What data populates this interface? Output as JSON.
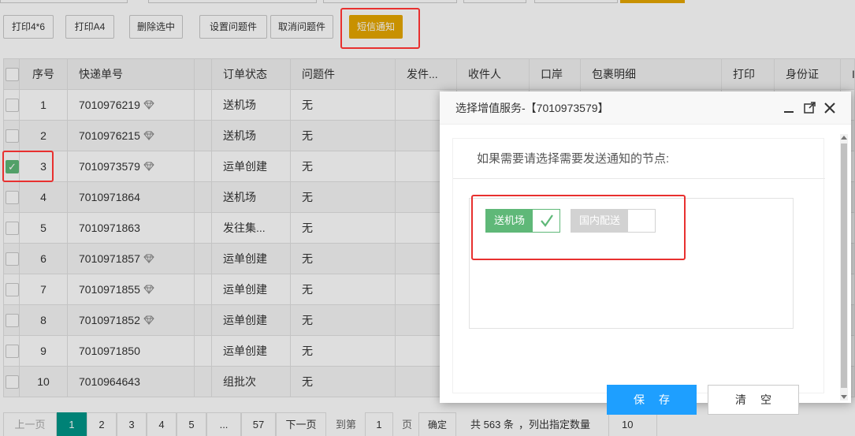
{
  "toolbar": {
    "print_4x6": "打印4*6",
    "print_a4": "打印A4",
    "delete_selected": "删除选中",
    "set_problem": "设置问题件",
    "cancel_problem": "取消问题件",
    "sms_notify": "短信通知"
  },
  "table": {
    "headers": [
      "序号",
      "快递单号",
      "订单状态",
      "问题件",
      "发件...",
      "收件人",
      "口岸",
      "包裹明细",
      "打印",
      "身份证",
      "I"
    ],
    "rows": [
      {
        "no": "1",
        "tracking": "7010976219",
        "gem": true,
        "status": "送机场",
        "problem": "无",
        "checked": false
      },
      {
        "no": "2",
        "tracking": "7010976215",
        "gem": true,
        "status": "送机场",
        "problem": "无",
        "checked": false
      },
      {
        "no": "3",
        "tracking": "7010973579",
        "gem": true,
        "status": "运单创建",
        "problem": "无",
        "checked": true
      },
      {
        "no": "4",
        "tracking": "7010971864",
        "gem": false,
        "status": "送机场",
        "problem": "无",
        "checked": false
      },
      {
        "no": "5",
        "tracking": "7010971863",
        "gem": false,
        "status": "发往集...",
        "problem": "无",
        "checked": false
      },
      {
        "no": "6",
        "tracking": "7010971857",
        "gem": true,
        "status": "运单创建",
        "problem": "无",
        "checked": false
      },
      {
        "no": "7",
        "tracking": "7010971855",
        "gem": true,
        "status": "运单创建",
        "problem": "无",
        "checked": false
      },
      {
        "no": "8",
        "tracking": "7010971852",
        "gem": true,
        "status": "运单创建",
        "problem": "无",
        "checked": false
      },
      {
        "no": "9",
        "tracking": "7010971850",
        "gem": false,
        "status": "运单创建",
        "problem": "无",
        "checked": false
      },
      {
        "no": "10",
        "tracking": "7010964643",
        "gem": false,
        "status": "组批次",
        "problem": "无",
        "checked": false
      }
    ]
  },
  "pager": {
    "prev": "上一页",
    "pages": [
      "1",
      "2",
      "3",
      "4",
      "5",
      "...",
      "57"
    ],
    "current": "1",
    "next": "下一页",
    "goto_label": "到第",
    "goto_value": "1",
    "page_unit": "页",
    "confirm": "确定",
    "total": "共 563 条",
    "per_page_label": "，列出指定数量",
    "per_page_value": "10"
  },
  "modal": {
    "title": "选择增值服务-【7010973579】",
    "prompt": "如果需要请选择需要发送通知的节点:",
    "nodes": [
      {
        "label": "送机场",
        "selected": true
      },
      {
        "label": "国内配送",
        "selected": false
      }
    ],
    "save": "保存",
    "clear": "清空"
  },
  "colors": {
    "accent_green": "#5fb878",
    "primary_blue": "#1e9fff",
    "warn_orange": "#e6a700",
    "highlight_red": "#e8302f",
    "pager_teal": "#009688"
  }
}
